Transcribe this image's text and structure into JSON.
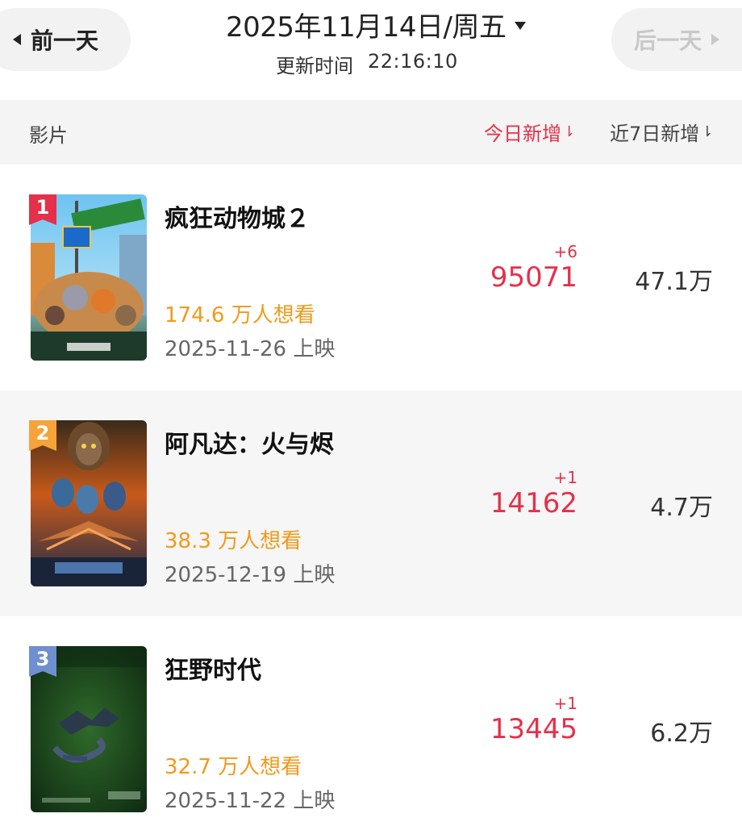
{
  "nav": {
    "prev_label": "前一天",
    "next_label": "后一天",
    "date": "2025年11月14日/周五",
    "update_label": "更新时间",
    "update_time": "22:16:10"
  },
  "header": {
    "film": "影片",
    "today_new": "今日新增",
    "week_new": "近7日新增"
  },
  "colors": {
    "accent_red": "#e5304a",
    "wish_orange": "#f09a1a",
    "rank1": "#e5304a",
    "rank2": "#f5a33a",
    "rank3": "#6f8fd0"
  },
  "movies": [
    {
      "rank": "1",
      "title": "疯狂动物城２",
      "wish": "174.6 万人想看",
      "release": "2025-11-26 上映",
      "delta": "+6",
      "today": "95071",
      "week": "47.1万"
    },
    {
      "rank": "2",
      "title": "阿凡达：火与烬",
      "wish": "38.3 万人想看",
      "release": "2025-12-19 上映",
      "delta": "+1",
      "today": "14162",
      "week": "4.7万"
    },
    {
      "rank": "3",
      "title": "狂野时代",
      "wish": "32.7 万人想看",
      "release": "2025-11-22 上映",
      "delta": "+1",
      "today": "13445",
      "week": "6.2万"
    }
  ]
}
